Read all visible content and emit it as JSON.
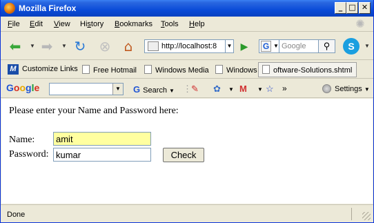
{
  "window": {
    "title": "Mozilla Firefox"
  },
  "menu": {
    "file": {
      "u": "F",
      "rest": "ile"
    },
    "edit": {
      "u": "E",
      "rest": "dit"
    },
    "view": {
      "u": "V",
      "rest": "iew"
    },
    "history": {
      "pre": "Hi",
      "u": "s",
      "rest": "tory"
    },
    "bookmarks": {
      "u": "B",
      "rest": "ookmarks"
    },
    "tools": {
      "u": "T",
      "rest": "ools"
    },
    "help": {
      "u": "H",
      "rest": "elp"
    }
  },
  "nav": {
    "url": "http://localhost:8",
    "search_placeholder": "Google"
  },
  "bookmarks": {
    "items": [
      "Customize Links",
      "Free Hotmail",
      "Windows Media",
      "Windows",
      "oftware-Solutions.shtml"
    ]
  },
  "google_toolbar": {
    "search_label": "Search",
    "settings_label": "Settings",
    "more": "»"
  },
  "page": {
    "intro": "Please enter your Name and Password here:",
    "name_label": "Name:",
    "password_label": "Password:",
    "name_value": "amit",
    "password_value": "kumar",
    "check_button": "Check"
  },
  "status": {
    "text": "Done"
  }
}
